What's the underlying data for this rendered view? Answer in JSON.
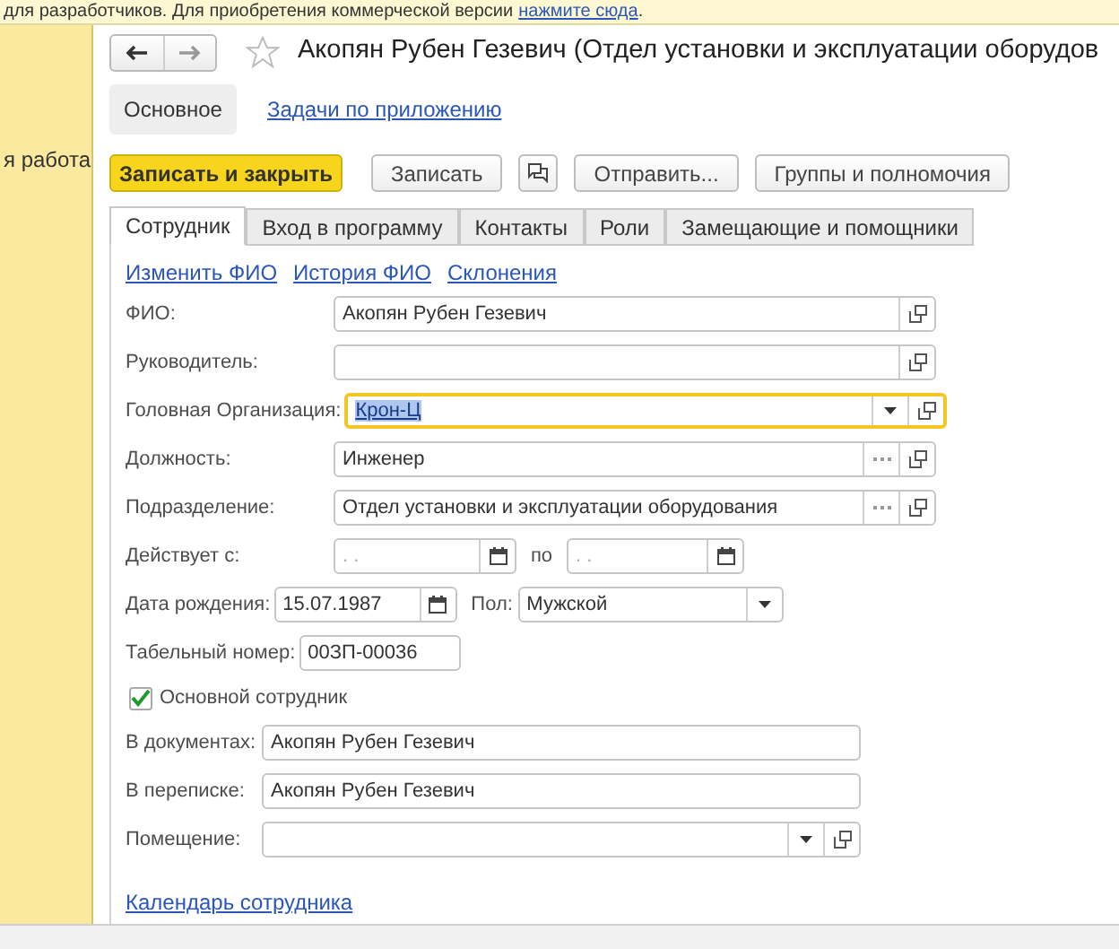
{
  "banner": {
    "text": "для разработчиков. Для приобретения коммерческой версии",
    "link": "нажмите сюда",
    "suffix": "."
  },
  "sidebar": {
    "items": [
      {
        "label": "я работа"
      }
    ]
  },
  "title": "Акопян Рубен Гезевич (Отдел установки и эксплуатации оборудов",
  "sections": [
    {
      "label": "Основное",
      "selected": true
    },
    {
      "label": "Задачи по приложению",
      "selected": false
    }
  ],
  "toolbar": [
    {
      "label": "Записать и закрыть",
      "kind": "primary"
    },
    {
      "label": "Записать",
      "kind": "normal"
    },
    {
      "kind": "icon"
    },
    {
      "label": "Отправить...",
      "kind": "normal"
    },
    {
      "label": "Группы и полномочия",
      "kind": "normal"
    }
  ],
  "tabs": [
    {
      "label": "Сотрудник",
      "selected": true
    },
    {
      "label": "Вход в программу",
      "selected": false
    },
    {
      "label": "Контакты",
      "selected": false
    },
    {
      "label": "Роли",
      "selected": false
    },
    {
      "label": "Замещающие и помощники",
      "selected": false
    }
  ],
  "links": [
    "Изменить ФИО",
    "История ФИО",
    "Склонения"
  ],
  "fields": [
    {
      "label": "ФИО:",
      "value": "Акопян Рубен Гезевич",
      "kind": "plain",
      "focused": false
    },
    {
      "label": "Руководитель:",
      "kind": "plain",
      "focused": false
    },
    {
      "label": "Головная Организация:",
      "value": "Крон-Ц",
      "kind": "select",
      "focused": true
    },
    {
      "label": "Должность:",
      "value": "Инженер",
      "kind": "lookup",
      "focused": false
    },
    {
      "label": "Подразделение:",
      "value": "Отдел установки и эксплуатации оборудования",
      "kind": "lookup",
      "focused": false
    }
  ],
  "active": {
    "label": "Действует с:",
    "from": ".  .",
    "to_label": "по",
    "to": ".  ."
  },
  "birth": {
    "label": "Дата рождения:",
    "value": "15.07.1987"
  },
  "gender": {
    "label": "Пол:",
    "value": "Мужской"
  },
  "tab_number": {
    "label": "Табельный номер:",
    "value": "00ЗП-00036"
  },
  "main_employee": {
    "label": "Основной сотрудник",
    "checked": true
  },
  "names": [
    {
      "label": "В документах:",
      "value": "Акопян Рубен Гезевич"
    },
    {
      "label": "В переписке:",
      "value": "Акопян Рубен Гезевич"
    }
  ],
  "room": {
    "label": "Помещение:",
    "kind": "select"
  },
  "calendar_link": "Календарь сотрудника"
}
